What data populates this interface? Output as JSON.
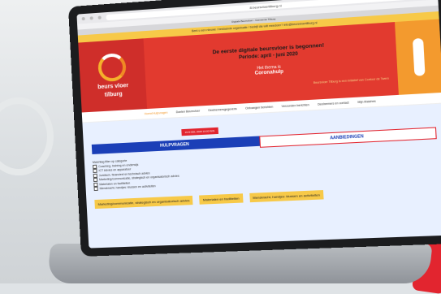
{
  "browser": {
    "url": "8-beursvloertilburg.nl",
    "tab_title": "Digitale Beursvloer - Gemeente Tilburg"
  },
  "notice": "Bent u een nieuwe / bestaande organisatie / bedrijf die wilt meedoen?  info@beursvloertilburg.nl",
  "hero": {
    "logo_line1": "beurs vloer",
    "logo_line2": "tilburg",
    "title": "De eerste digitale beursvloer is begonnen!",
    "period": "Periode: april - juni 2020",
    "theme_label": "Het thema is",
    "theme": "Coronahulp",
    "footnote": "Beursvloer Tilburg is een initiatief van Contour de Twern"
  },
  "nav": [
    {
      "label": "Home/Hulpvragen",
      "active": true
    },
    {
      "label": "Doelen Beursvloer",
      "active": false
    },
    {
      "label": "Deelnemersgegevens",
      "active": false
    },
    {
      "label": "Ontvangen berichten",
      "active": false
    },
    {
      "label": "Verzonden berichten",
      "active": false
    },
    {
      "label": "Deelnemers en contact",
      "active": false
    },
    {
      "label": "Mijn Matches",
      "active": false
    }
  ],
  "content": {
    "date_badge": "19 M EEL 2020 10:00 WIN",
    "tabs": {
      "help": "HULPVRAGEN",
      "offer": "AANBIEDINGEN"
    },
    "filter_title": "Matchtag filter op categorie",
    "filters": [
      "Coaching, training en onderwijs",
      "ICT Advies en apparatuur",
      "Juridisch, financieel en technisch advies",
      "Marketing/communicatie, strategisch en organisatorisch advies",
      "Materialen en faciliteiten",
      "Menskracht, handjes: klussen en activiteiten"
    ],
    "cards": [
      "Marketing/communicatie, strategisch en organisatorisch advies",
      "Materialen en faciliteiten",
      "Menskracht, handjes: klussen en activiteiten"
    ]
  },
  "colors": {
    "hero_red": "#e23a2f",
    "accent_orange": "#f39a2e",
    "help_blue": "#1b3fb7",
    "card_yellow": "#f7c948"
  }
}
